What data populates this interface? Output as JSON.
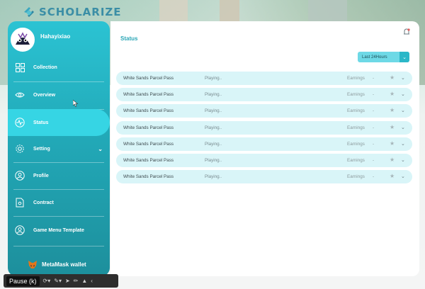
{
  "app": {
    "logo_text": "SCHOLARIZE",
    "accent_color": "#2bc3d3"
  },
  "sidebar": {
    "username": "Hahayixiao",
    "items": [
      {
        "label": "Collection",
        "icon": "grid-icon"
      },
      {
        "label": "Overview",
        "icon": "eye-icon"
      },
      {
        "label": "Status",
        "icon": "pulse-icon",
        "active": true
      },
      {
        "label": "Setting",
        "icon": "gear-icon",
        "has_submenu": true
      },
      {
        "label": "Profile",
        "icon": "user-icon"
      },
      {
        "label": "Contract",
        "icon": "document-icon"
      },
      {
        "label": "Game Menu Template",
        "icon": "user-circle-icon"
      }
    ],
    "wallet_label": "MetaMask wallet"
  },
  "main": {
    "title": "Status",
    "filter_label": "Last 24Hours",
    "rows": [
      {
        "name": "White Sands Parcel Pass",
        "state": "Playing..",
        "earnings_label": "Earnings",
        "earnings_value": "-"
      },
      {
        "name": "White Sands Parcel Pass",
        "state": "Playing..",
        "earnings_label": "Earnings",
        "earnings_value": "-"
      },
      {
        "name": "White Sands Parcel Pass",
        "state": "Playing..",
        "earnings_label": "Earnings",
        "earnings_value": "-"
      },
      {
        "name": "White Sands Parcel Pass",
        "state": "Playing..",
        "earnings_label": "Earnings",
        "earnings_value": "-"
      },
      {
        "name": "White Sands Parcel Pass",
        "state": "Playing..",
        "earnings_label": "Earnings",
        "earnings_value": "-"
      },
      {
        "name": "White Sands Parcel Pass",
        "state": "Playing..",
        "earnings_label": "Earnings",
        "earnings_value": "-"
      },
      {
        "name": "White Sands Parcel Pass",
        "state": "Playing..",
        "earnings_label": "Earnings",
        "earnings_value": "-"
      }
    ]
  },
  "toolbar": {
    "pause_label": "Pause (k)"
  }
}
